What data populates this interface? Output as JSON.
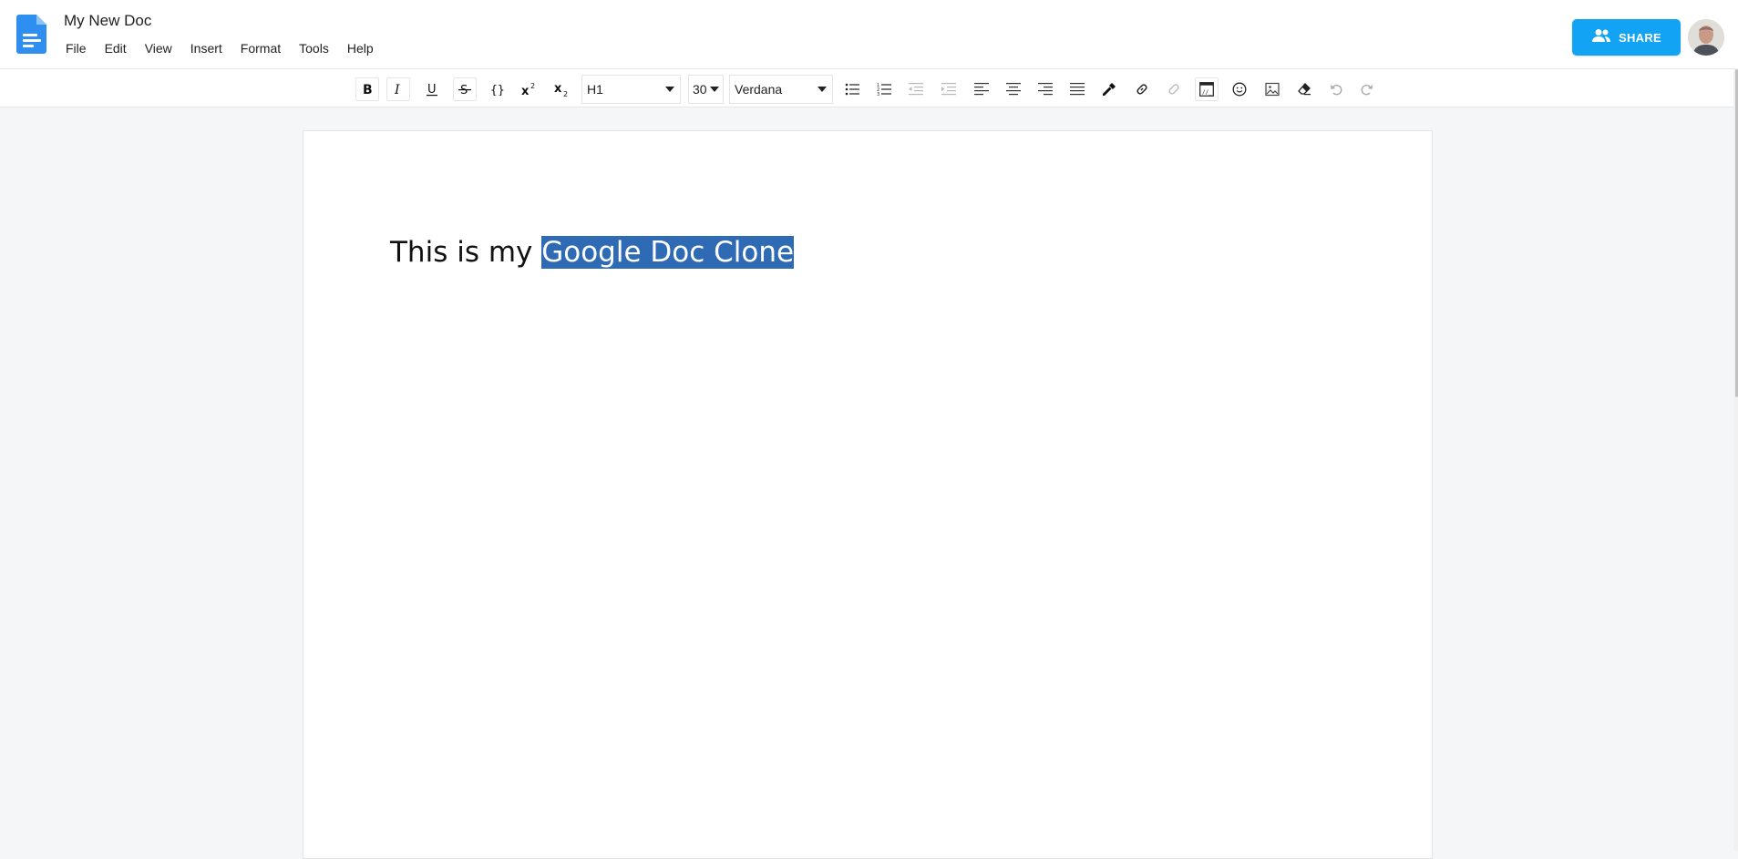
{
  "header": {
    "doc_title": "My New Doc",
    "menu": [
      "File",
      "Edit",
      "View",
      "Insert",
      "Format",
      "Tools",
      "Help"
    ],
    "share_label": "SHARE",
    "icons": {
      "doc": "document-icon",
      "share": "people-icon",
      "avatar": "user-avatar"
    },
    "accent_color": "#13a3f4"
  },
  "toolbar": {
    "heading_select": "H1",
    "size_select": "30",
    "font_select": "Verdana",
    "buttons": [
      "bold",
      "italic",
      "underline",
      "strikethrough",
      "code-inline",
      "superscript",
      "subscript",
      "bullet-list",
      "numbered-list",
      "outdent",
      "indent",
      "align-left",
      "align-center",
      "align-right",
      "justify",
      "color-picker",
      "link",
      "unlink",
      "code-block",
      "emoji",
      "image",
      "clear-format",
      "undo",
      "redo"
    ]
  },
  "document": {
    "text_plain": "This is my ",
    "text_selected": "Google Doc Clone",
    "selection_color": "#2f6bb5"
  }
}
